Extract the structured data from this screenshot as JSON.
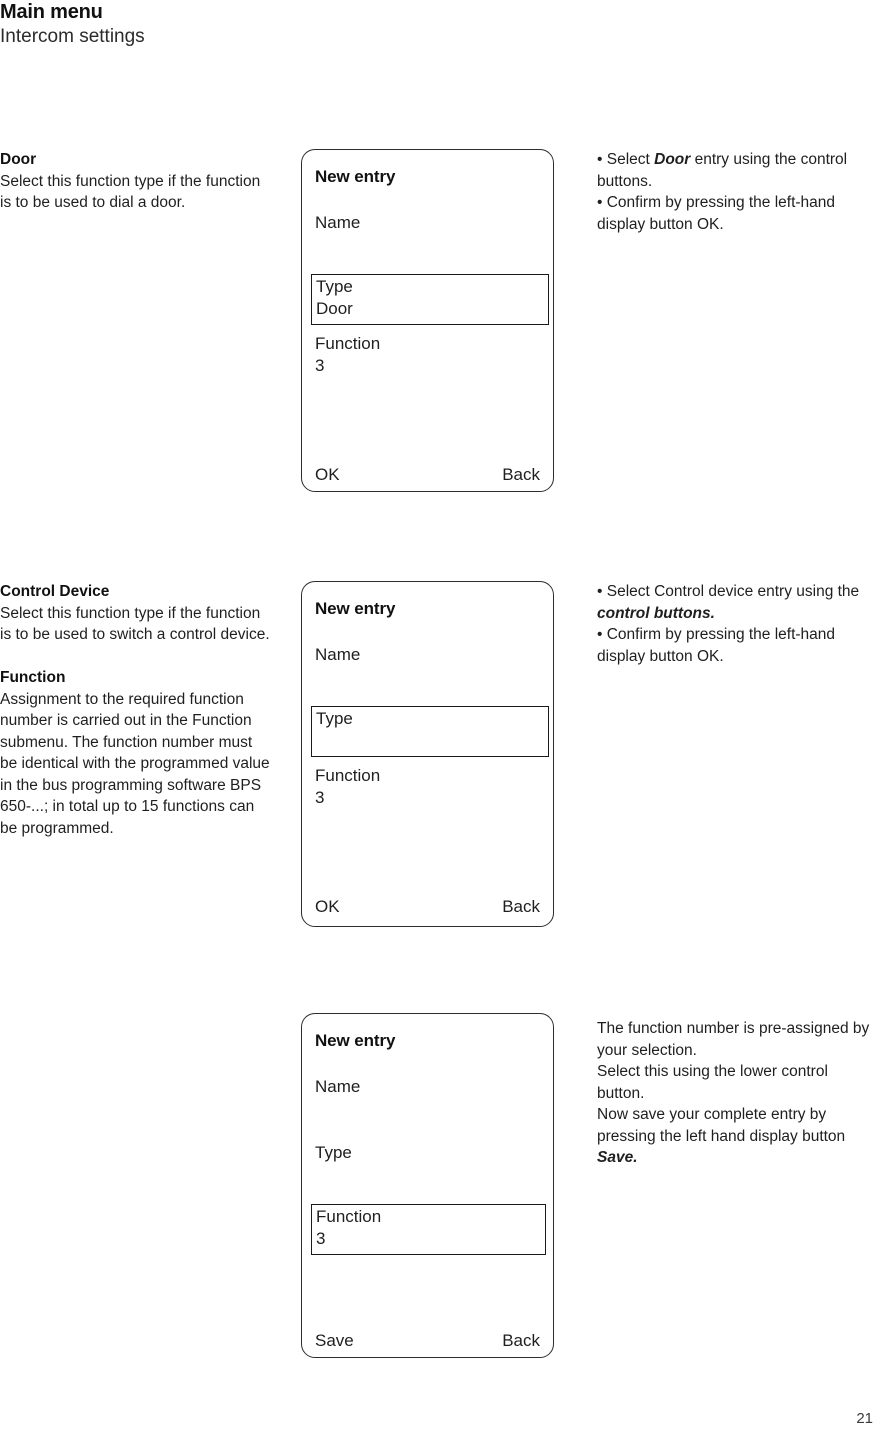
{
  "header": {
    "title": "Main menu",
    "subtitle": "Intercom settings"
  },
  "sections": [
    {
      "left": {
        "heading": "Door",
        "body": "Select this function type if the function is to be used to dial a door."
      },
      "screen": {
        "title": "New entry",
        "rows": [
          {
            "label": "Name",
            "value": "",
            "selected": false
          },
          {
            "label": "Type",
            "value": "Door",
            "selected": true
          },
          {
            "label": "Function",
            "value": "3",
            "selected": false
          }
        ],
        "softkey_left": "OK",
        "softkey_right": "Back"
      },
      "right": {
        "bullet1_pre": "• Select ",
        "bullet1_em": "Door",
        "bullet1_post": " entry using the control buttons.",
        "bullet2": "• Confirm by pressing the left-hand display button OK."
      }
    },
    {
      "left": {
        "heading": "Control Device",
        "body": "Select this function type if the function is to be used to switch a control device.",
        "heading2": "Function",
        "body2": "Assignment to the required function number is carried out in the Function submenu. The function number must be identical with the programmed value in the bus programming software BPS 650-...; in total up to 15 functions can be programmed."
      },
      "screen": {
        "title": "New entry",
        "rows": [
          {
            "label": "Name",
            "value": "",
            "selected": false
          },
          {
            "label": "Type",
            "value": "",
            "selected": true
          },
          {
            "label": "Function",
            "value": "3",
            "selected": false
          }
        ],
        "softkey_left": "OK",
        "softkey_right": "Back"
      },
      "right": {
        "bullet1_pre": "• Select Control device entry using the ",
        "bullet1_em": "control buttons.",
        "bullet1_post": "",
        "bullet2": "• Confirm by pressing the left-hand display button OK."
      }
    },
    {
      "left": {
        "heading": "",
        "body": ""
      },
      "screen": {
        "title": "New entry",
        "rows": [
          {
            "label": "Name",
            "value": "",
            "selected": false
          },
          {
            "label": "Type",
            "value": "",
            "selected": false
          },
          {
            "label": "Function",
            "value": "3",
            "selected": true
          }
        ],
        "softkey_left": "Save",
        "softkey_right": "Back"
      },
      "right": {
        "bullet1_pre": "The function number is pre-assigned by your selection.\nSelect this using the lower control button.\nNow save your complete entry by pressing the left hand display button ",
        "bullet1_em": "Save.",
        "bullet1_post": "",
        "bullet2": ""
      }
    }
  ],
  "page_number": "21"
}
